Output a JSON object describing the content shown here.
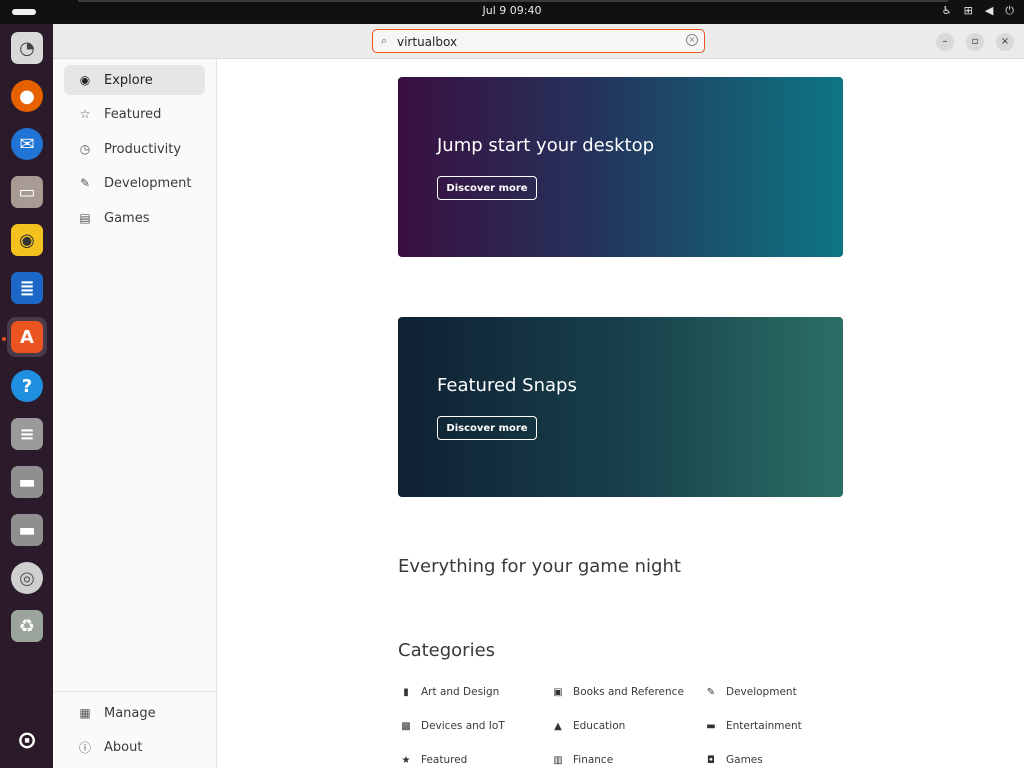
{
  "topbar": {
    "datetime": "Jul 9  09:40",
    "status_icons": [
      "accessibility-icon",
      "network-icon",
      "volume-icon",
      "power-icon"
    ]
  },
  "dock": {
    "apps": [
      {
        "name": "disk-usage-icon",
        "color": "#d9d9d9",
        "glyph": "◔"
      },
      {
        "name": "firefox-icon",
        "color": "#e66000",
        "glyph": "●"
      },
      {
        "name": "thunderbird-icon",
        "color": "#1f74d6",
        "glyph": "✉"
      },
      {
        "name": "files-icon",
        "color": "#a79b94",
        "glyph": "▭"
      },
      {
        "name": "rhythmbox-icon",
        "color": "#f3c21c",
        "glyph": "◉"
      },
      {
        "name": "writer-icon",
        "color": "#1c68c8",
        "glyph": "≣"
      },
      {
        "name": "app-center-icon",
        "color": "#e95420",
        "glyph": "A"
      },
      {
        "name": "help-icon",
        "color": "#1f8fe0",
        "glyph": "?"
      },
      {
        "name": "floppy-icon",
        "color": "#9a9a9a",
        "glyph": "≡"
      },
      {
        "name": "drive-icon",
        "color": "#8f8f8f",
        "glyph": "▬"
      },
      {
        "name": "drive-2-icon",
        "color": "#8f8f8f",
        "glyph": "▬"
      },
      {
        "name": "disc-icon",
        "color": "#cfcfcf",
        "glyph": "◎"
      },
      {
        "name": "trash-icon",
        "color": "#9ba49a",
        "glyph": "♻"
      },
      {
        "name": "show-apps-icon",
        "color": "#2b1a2a",
        "glyph": "⊙"
      }
    ]
  },
  "search": {
    "value": "virtualbox",
    "placeholder": ""
  },
  "sidebar": {
    "items": [
      {
        "label": "Explore",
        "icon": "compass-icon"
      },
      {
        "label": "Featured",
        "icon": "star-icon"
      },
      {
        "label": "Productivity",
        "icon": "clock-icon"
      },
      {
        "label": "Development",
        "icon": "wrench-icon"
      },
      {
        "label": "Games",
        "icon": "gamepad-icon"
      }
    ],
    "footer": [
      {
        "label": "Manage",
        "icon": "manage-icon"
      },
      {
        "label": "About",
        "icon": "info-icon"
      }
    ]
  },
  "banners": [
    {
      "title": "Jump start your desktop",
      "button": "Discover more"
    },
    {
      "title": "Featured Snaps",
      "button": "Discover more"
    }
  ],
  "sections": {
    "game_night": "Everything for your game night",
    "categories": "Categories"
  },
  "categories": [
    {
      "label": "Art and Design",
      "icon": "art-icon"
    },
    {
      "label": "Books and Reference",
      "icon": "book-icon"
    },
    {
      "label": "Development",
      "icon": "wrench-icon"
    },
    {
      "label": "Devices and IoT",
      "icon": "chip-icon"
    },
    {
      "label": "Education",
      "icon": "graduation-cap-icon"
    },
    {
      "label": "Entertainment",
      "icon": "tv-icon"
    },
    {
      "label": "Featured",
      "icon": "star-icon"
    },
    {
      "label": "Finance",
      "icon": "finance-icon"
    },
    {
      "label": "Games",
      "icon": "gamepad-icon"
    }
  ],
  "colors": {
    "accent": "#e95420",
    "dock_bg": "#2b1a2a"
  }
}
